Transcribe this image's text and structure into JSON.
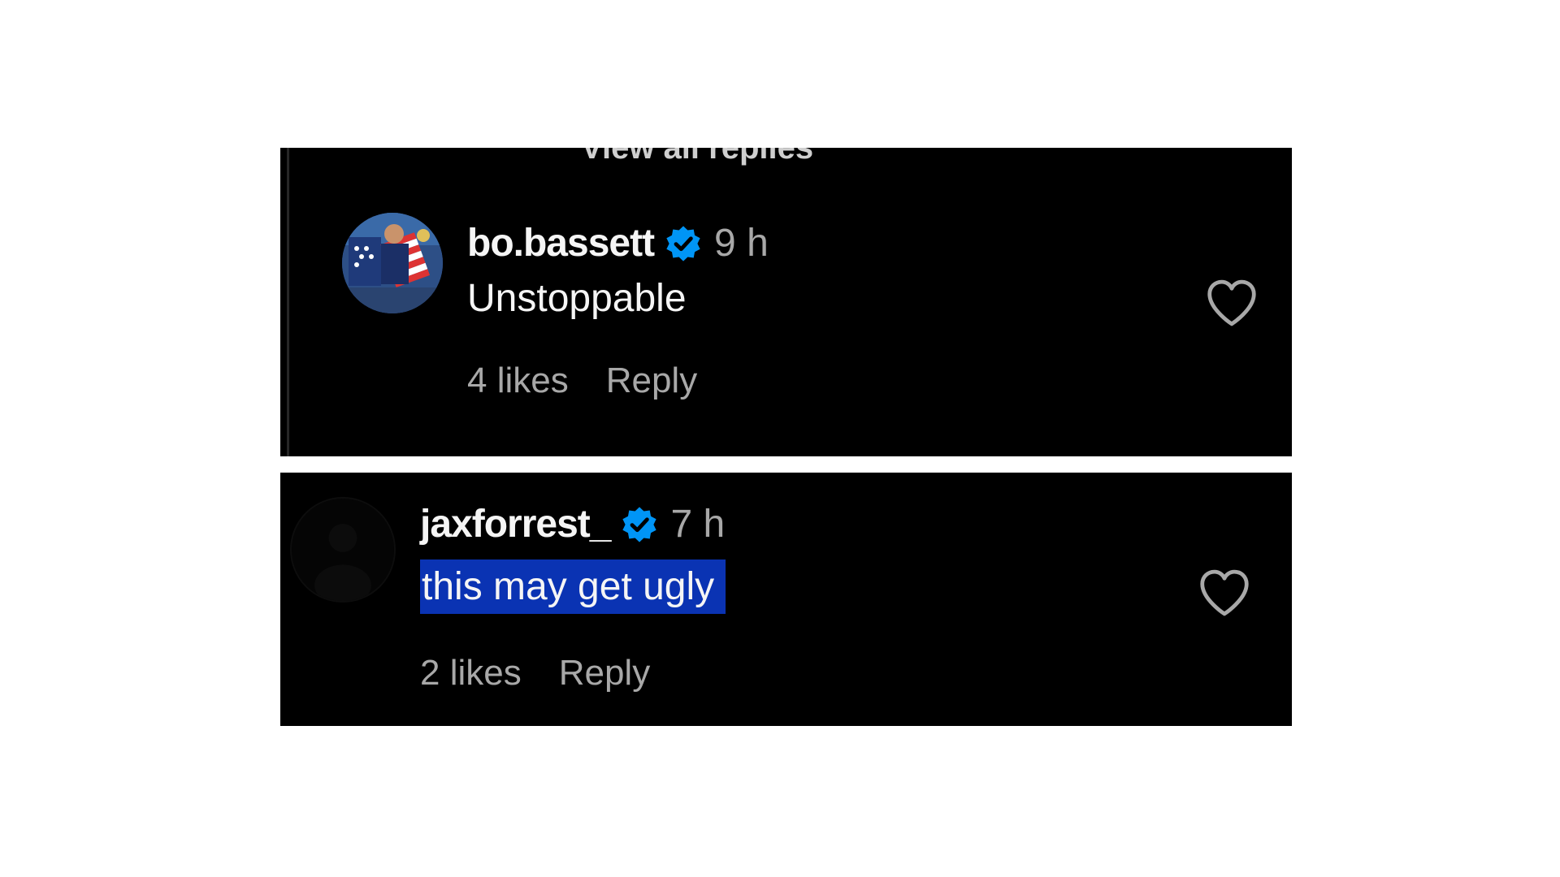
{
  "partial_header_text": "View all replies",
  "comments": [
    {
      "username": "bo.bassett",
      "verified": true,
      "time": "9 h",
      "text": "Unstoppable",
      "likes": "4 likes",
      "reply": "Reply",
      "liked": false,
      "highlighted": false
    },
    {
      "username": "jaxforrest_",
      "verified": true,
      "time": "7 h",
      "text": "this may get ugly",
      "likes": "2 likes",
      "reply": "Reply",
      "liked": false,
      "highlighted": true
    }
  ],
  "colors": {
    "background": "#000000",
    "primary_text": "#f5f5f5",
    "secondary_text": "#a8a8a8",
    "verified_badge": "#0095f6",
    "selection_highlight": "#0a33b3"
  },
  "icons": {
    "verified": "verified-badge-icon",
    "like": "heart-outline-icon"
  }
}
